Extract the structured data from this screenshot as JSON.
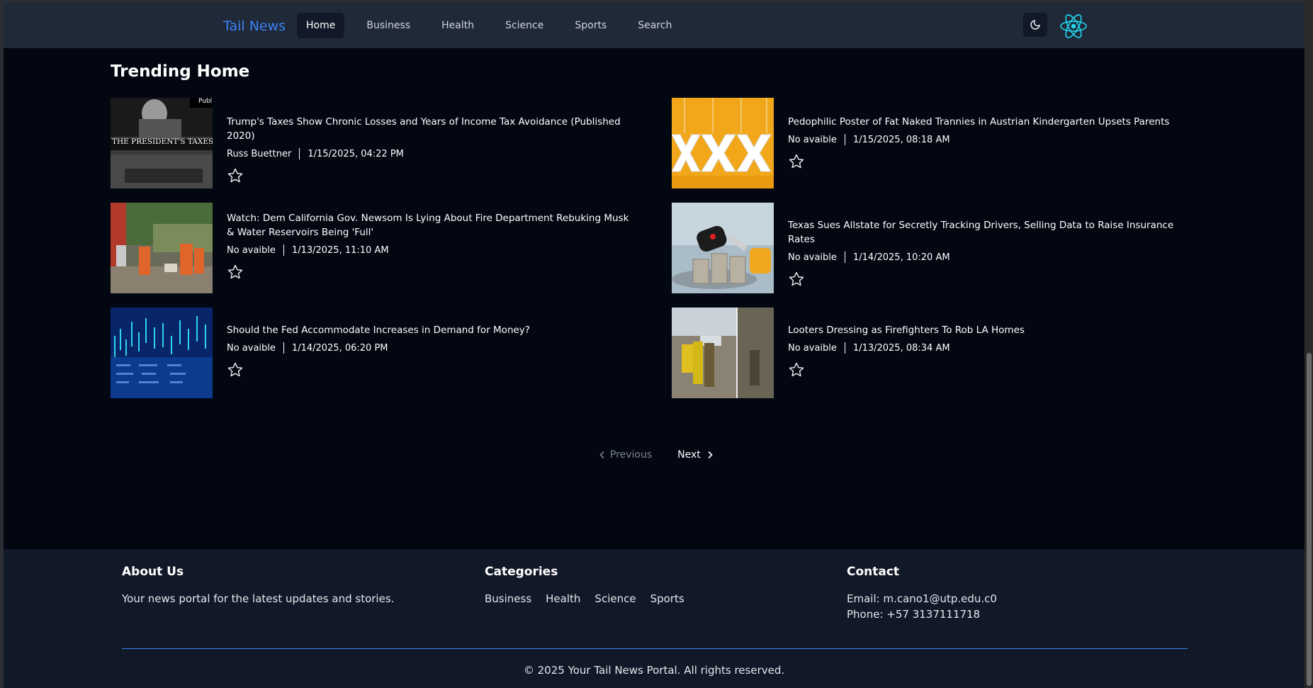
{
  "nav": {
    "brand": "Tail News",
    "links": [
      "Home",
      "Business",
      "Health",
      "Science",
      "Sports",
      "Search"
    ],
    "active": "Home"
  },
  "main": {
    "title": "Trending Home",
    "articles": [
      {
        "title": "Trump's Taxes Show Chronic Losses and Years of Income Tax Avoidance (Published 2020)",
        "author": "Russ Buettner",
        "date": "1/15/2025, 04:22 PM",
        "image_caption": "THE PRESIDENT'S TAXES",
        "image_tag": "Publ"
      },
      {
        "title": "Pedophilic Poster of Fat Naked Trannies in Austrian Kindergarten Upsets Parents",
        "author": "No avaible",
        "date": "1/15/2025, 08:18 AM"
      },
      {
        "title": "Watch: Dem California Gov. Newsom Is Lying About Fire Department Rebuking Musk & Water Reservoirs Being 'Full'",
        "author": "No avaible",
        "date": "1/13/2025, 11:10 AM"
      },
      {
        "title": "Texas Sues Allstate for Secretly Tracking Drivers, Selling Data to Raise Insurance Rates",
        "author": "No avaible",
        "date": "1/14/2025, 10:20 AM"
      },
      {
        "title": "Should the Fed Accommodate Increases in Demand for Money?",
        "author": "No avaible",
        "date": "1/14/2025, 06:20 PM"
      },
      {
        "title": "Looters Dressing as Firefighters To Rob LA Homes",
        "author": "No avaible",
        "date": "1/13/2025, 08:34 AM"
      }
    ]
  },
  "pagination": {
    "previous": "Previous",
    "next": "Next"
  },
  "footer": {
    "about_title": "About Us",
    "about_text": "Your news portal for the latest updates and stories.",
    "categories_title": "Categories",
    "categories": [
      "Business",
      "Health",
      "Science",
      "Sports"
    ],
    "contact_title": "Contact",
    "email": "Email: m.cano1@utp.edu.c0",
    "phone": "Phone: +57 3137111718",
    "copyright": "© 2025 Your Tail News Portal. All rights reserved."
  },
  "colors": {
    "brand": "#3b82f6",
    "page_bg": "#030712",
    "nav_bg": "#1f2937",
    "footer_bg": "#111827",
    "react": "#22d3ee"
  }
}
